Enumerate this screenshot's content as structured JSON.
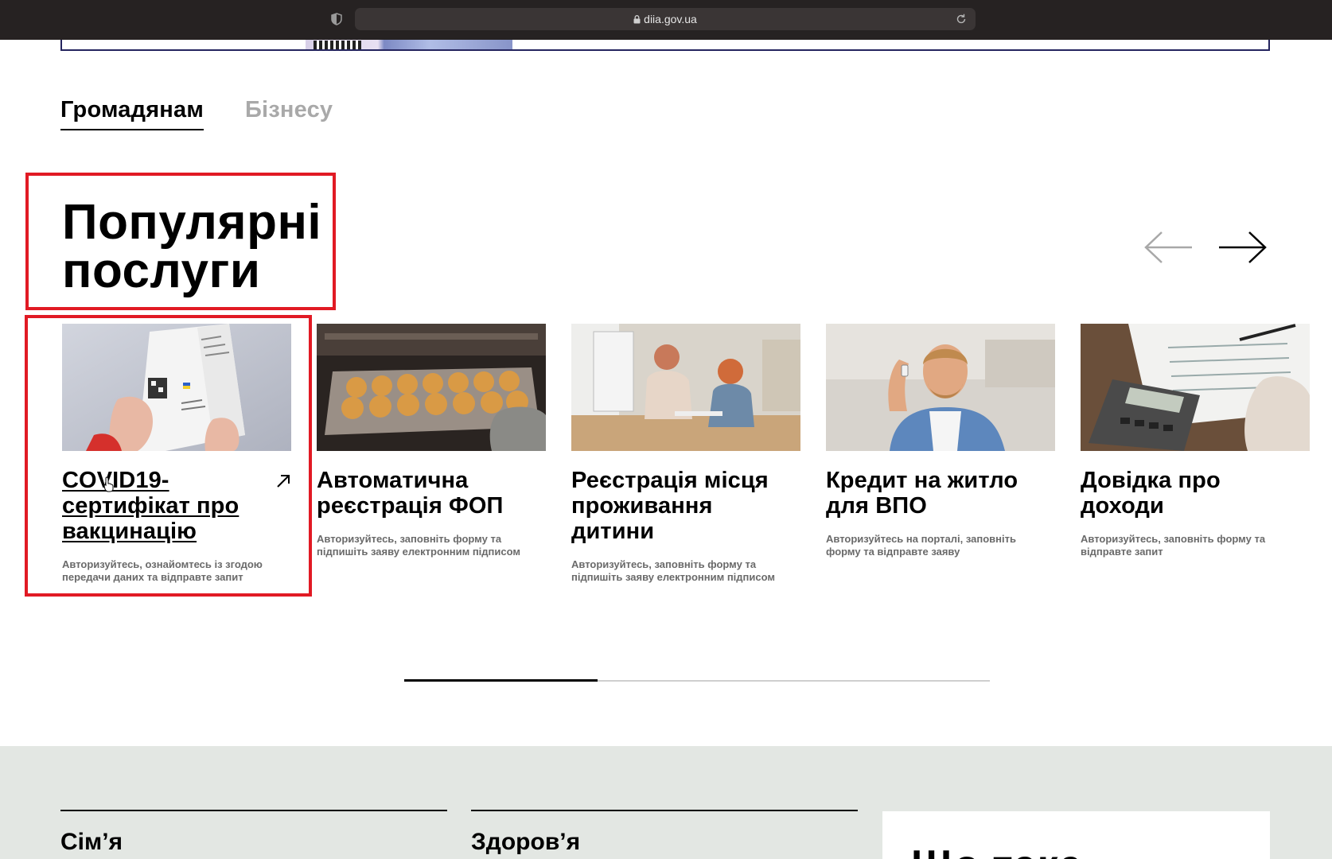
{
  "browser": {
    "url": "diia.gov.ua"
  },
  "tabs": [
    {
      "label": "Громадянам",
      "active": true
    },
    {
      "label": "Бізнесу",
      "active": false
    }
  ],
  "section": {
    "title": "Популярні послуги"
  },
  "carousel": {
    "prev_icon": "arrow-left-icon",
    "next_icon": "arrow-right-icon",
    "progress_fraction": 0.33
  },
  "cards": [
    {
      "title": "COVID19-сертифікат про вакцинацію",
      "description": "Авторизуйтесь, ознайомтесь із згодою передачи даних та відправте запит",
      "icon": "external-link-icon"
    },
    {
      "title": "Автоматична реєстрація ФОП",
      "description": "Авторизуйтесь, заповніть форму та підпишіть заяву електронним підписом"
    },
    {
      "title": "Реєстрація місця проживання дитини",
      "description": "Авторизуйтесь, заповніть форму та підпишіть заяву електронним підписом"
    },
    {
      "title": "Кредит на житло для ВПО",
      "description": "Авторизуйтесь на порталі, заповніть форму та відправте заяву"
    },
    {
      "title": "Довідка про доходи",
      "description": "Авторизуйтесь, заповніть форму та відправте запит"
    }
  ],
  "categories": [
    {
      "label": "Сім’я"
    },
    {
      "label": "Здоров’я"
    }
  ],
  "info_box": {
    "title": "Що таке"
  },
  "colors": {
    "highlight": "#e11a24",
    "bottom_band": "#e3e7e3",
    "muted_text": "#a9a9a9"
  }
}
